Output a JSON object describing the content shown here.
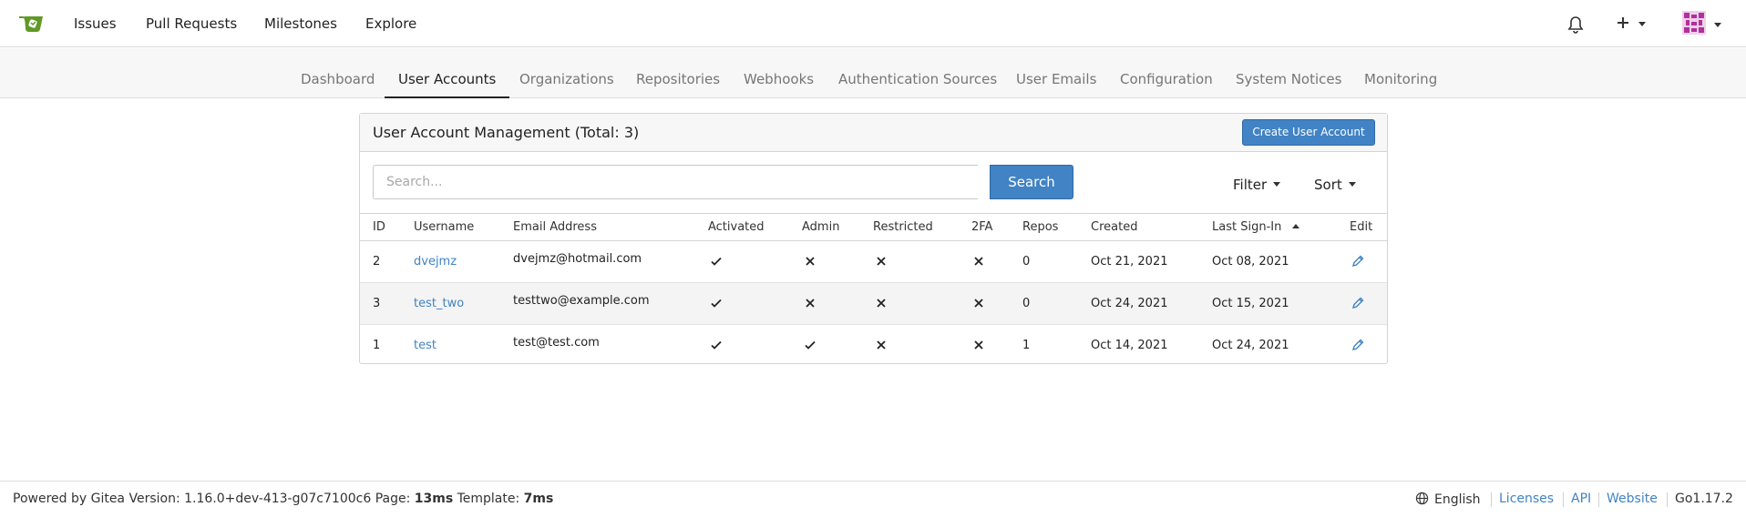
{
  "topnav": {
    "links": [
      "Issues",
      "Pull Requests",
      "Milestones",
      "Explore"
    ]
  },
  "tabs": [
    {
      "label": "Dashboard",
      "active": false
    },
    {
      "label": "User Accounts",
      "active": true
    },
    {
      "label": "Organizations",
      "active": false
    },
    {
      "label": "Repositories",
      "active": false
    },
    {
      "label": "Webhooks",
      "active": false
    },
    {
      "label": "Authentication Sources",
      "active": false
    },
    {
      "label": "User Emails",
      "active": false
    },
    {
      "label": "Configuration",
      "active": false
    },
    {
      "label": "System Notices",
      "active": false
    },
    {
      "label": "Monitoring",
      "active": false
    }
  ],
  "panel": {
    "title": "User Account Management (Total: 3)",
    "create_label": "Create User Account"
  },
  "search": {
    "placeholder": "Search...",
    "button_label": "Search",
    "filter_label": "Filter",
    "sort_label": "Sort"
  },
  "table": {
    "headers": [
      "ID",
      "Username",
      "Email Address",
      "Activated",
      "Admin",
      "Restricted",
      "2FA",
      "Repos",
      "Created",
      "Last Sign-In",
      "Edit"
    ],
    "sorted_column": "Last Sign-In",
    "rows": [
      {
        "id": "2",
        "username": "dvejmz",
        "email": "dvejmz@hotmail.com",
        "activated": true,
        "admin": false,
        "restricted": false,
        "twofa": false,
        "repos": "0",
        "created": "Oct 21, 2021",
        "last_signin": "Oct 08, 2021"
      },
      {
        "id": "3",
        "username": "test_two",
        "email": "testtwo@example.com",
        "activated": true,
        "admin": false,
        "restricted": false,
        "twofa": false,
        "repos": "0",
        "created": "Oct 24, 2021",
        "last_signin": "Oct 15, 2021"
      },
      {
        "id": "1",
        "username": "test",
        "email": "test@test.com",
        "activated": true,
        "admin": true,
        "restricted": false,
        "twofa": false,
        "repos": "1",
        "created": "Oct 14, 2021",
        "last_signin": "Oct 24, 2021"
      }
    ]
  },
  "footer": {
    "powered_prefix": "Powered by Gitea Version: 1.16.0+dev-413-g07c7100c6 Page:",
    "page_time": "13ms",
    "template_prefix": "Template:",
    "template_time": "7ms",
    "language": "English",
    "licenses": "Licenses",
    "api": "API",
    "website": "Website",
    "go_version": "Go1.17.2"
  },
  "colors": {
    "accent": "#4183c4",
    "logo": "#609926"
  }
}
